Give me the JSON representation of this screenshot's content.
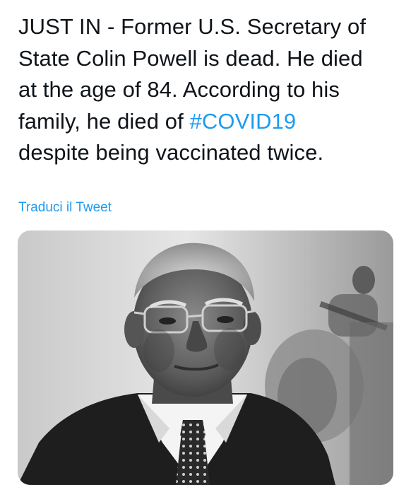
{
  "tweet": {
    "text_before": "JUST IN - Former U.S. Secretary of\nState Colin Powell is dead. He died\nat the age of 84. According to his\nfamily, he died of ",
    "hashtag": "#COVID19",
    "text_after": "\ndespite being vaccinated twice.",
    "translate_label": "Traduci il Tweet"
  },
  "media": {
    "image_description_icon": "photo",
    "style": "black-and-white"
  },
  "colors": {
    "link": "#1d9bf0",
    "text": "#0f1419",
    "background": "#ffffff"
  }
}
